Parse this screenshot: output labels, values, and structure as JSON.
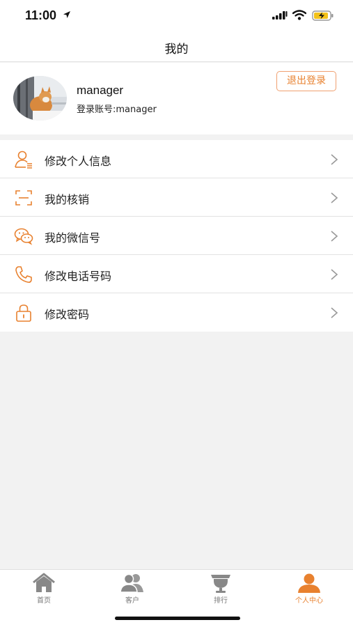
{
  "status_bar": {
    "time": "11:00"
  },
  "nav": {
    "title": "我的"
  },
  "profile": {
    "username": "manager",
    "account": "登录账号:manager",
    "logout_label": "退出登录"
  },
  "menu": [
    {
      "label": "修改个人信息",
      "icon": "user-edit-icon"
    },
    {
      "label": "我的核销",
      "icon": "scan-icon"
    },
    {
      "label": "我的微信号",
      "icon": "wechat-icon"
    },
    {
      "label": "修改电话号码",
      "icon": "phone-icon"
    },
    {
      "label": "修改密码",
      "icon": "lock-icon"
    }
  ],
  "tabs": [
    {
      "label": "首页",
      "icon": "home-icon",
      "active": false
    },
    {
      "label": "客户",
      "icon": "customers-icon",
      "active": false
    },
    {
      "label": "排行",
      "icon": "ranking-icon",
      "active": false
    },
    {
      "label": "个人中心",
      "icon": "profile-icon",
      "active": true
    }
  ],
  "colors": {
    "accent": "#e8812f",
    "background": "#f2f2f2",
    "tab_inactive": "#777777"
  }
}
